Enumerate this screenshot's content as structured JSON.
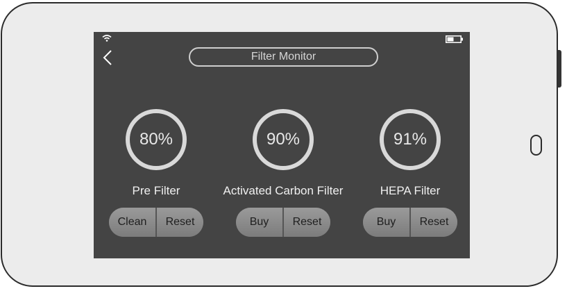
{
  "screen": {
    "title": "Filter Monitor",
    "back_icon": "chevron-left-icon",
    "status": {
      "wifi_icon": "wifi-icon",
      "battery_icon": "battery-icon",
      "battery_level": 0.5
    }
  },
  "filters": [
    {
      "name": "Pre Filter",
      "percent_label": "80%",
      "percent": 80,
      "actions": [
        "Clean",
        "Reset"
      ]
    },
    {
      "name": "Activated Carbon Filter",
      "percent_label": "90%",
      "percent": 90,
      "actions": [
        "Buy",
        "Reset"
      ]
    },
    {
      "name": "HEPA Filter",
      "percent_label": "91%",
      "percent": 91,
      "actions": [
        "Buy",
        "Reset"
      ]
    }
  ],
  "colors": {
    "screen_bg": "#444444",
    "ring": "#d9d9d9",
    "text": "#f0f0f0"
  }
}
